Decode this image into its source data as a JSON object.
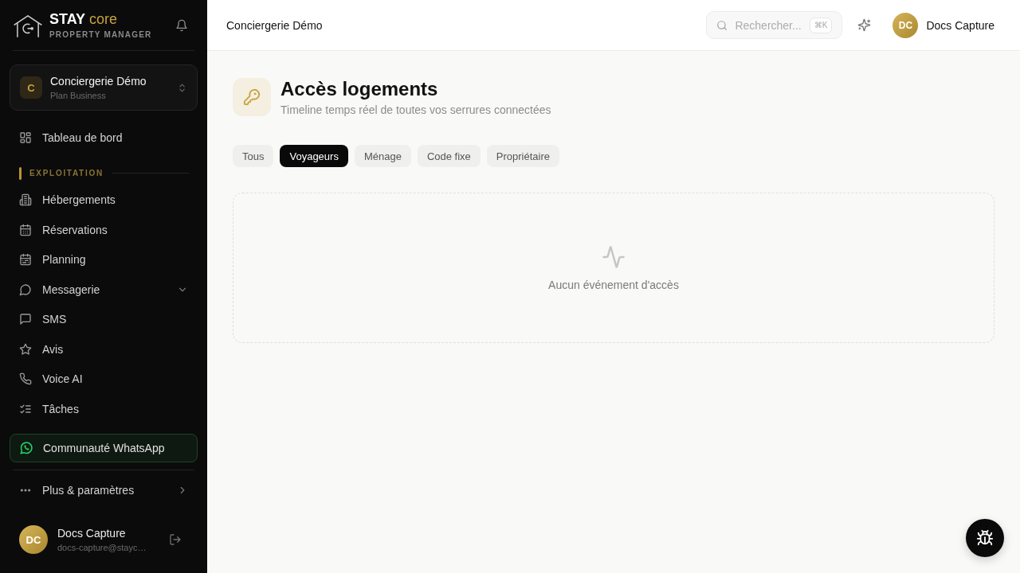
{
  "sidebar": {
    "logo": {
      "name": "STAY",
      "suffix": "core",
      "tagline": "PROPERTY MANAGER"
    },
    "workspace": {
      "initial": "C",
      "name": "Conciergerie Démo",
      "plan": "Plan Business"
    },
    "nav": [
      {
        "kind": "link",
        "label": "Tableau de bord",
        "selected": false
      },
      {
        "kind": "section",
        "label": "EXPLOITATION"
      },
      {
        "kind": "link",
        "label": "Hébergements",
        "selected": false
      },
      {
        "kind": "link",
        "label": "Réservations",
        "selected": false
      },
      {
        "kind": "link",
        "label": "Planning",
        "selected": false
      },
      {
        "kind": "group",
        "label": "Messagerie",
        "selected": false,
        "expanded": false
      },
      {
        "kind": "link",
        "label": "SMS",
        "selected": false
      },
      {
        "kind": "link",
        "label": "Avis",
        "selected": false
      },
      {
        "kind": "link",
        "label": "Voice AI",
        "selected": false
      },
      {
        "kind": "link",
        "label": "Tâches",
        "selected": false
      }
    ],
    "community": {
      "label": "Communauté WhatsApp"
    },
    "more": {
      "label": "Plus & paramètres"
    },
    "user": {
      "initials": "DC",
      "name": "Docs Capture",
      "email": "docs-capture@stayc…"
    }
  },
  "topbar": {
    "title": "Conciergerie Démo",
    "search": {
      "placeholder": "Rechercher...",
      "shortcut": "⌘K"
    },
    "user": {
      "initials": "DC",
      "name": "Docs Capture"
    }
  },
  "page": {
    "title": "Accès logements",
    "subtitle": "Timeline temps réel de toutes vos serrures connectées",
    "filters": [
      {
        "label": "Tous",
        "selected": false
      },
      {
        "label": "Voyageurs",
        "selected": true
      },
      {
        "label": "Ménage",
        "selected": false
      },
      {
        "label": "Code fixe",
        "selected": false
      },
      {
        "label": "Propriétaire",
        "selected": false
      }
    ],
    "empty": {
      "message": "Aucun événement d'accès"
    }
  }
}
